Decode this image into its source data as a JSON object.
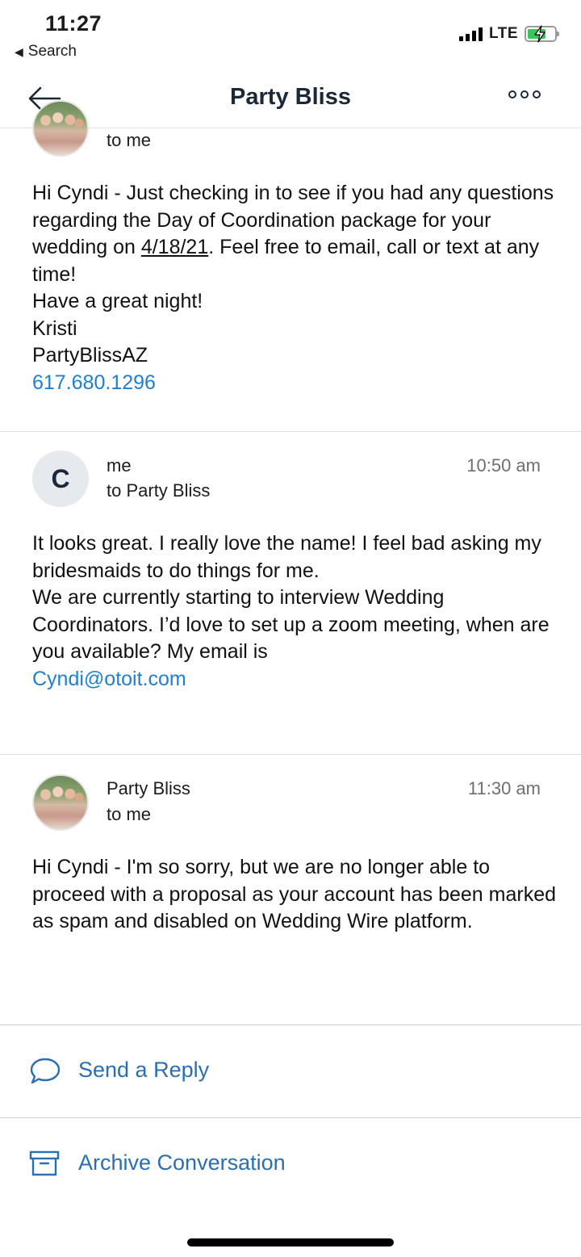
{
  "status_bar": {
    "time": "11:27",
    "back_label": "Search",
    "network": "LTE"
  },
  "nav": {
    "title": "Party Bliss"
  },
  "messages": [
    {
      "recipient": "to me",
      "paragraphs": {
        "p1_before": "Hi Cyndi - Just checking in to see if you had any questions regarding the Day of Coordination package for your wedding on ",
        "p1_date": "4/18/21",
        "p1_after": ". Feel free to email, call or text at any time!",
        "line2": "Have a great night!",
        "line3": "Kristi",
        "line4": "PartyBlissAZ",
        "phone": "617.680.1296"
      }
    },
    {
      "avatar_letter": "C",
      "sender": "me",
      "recipient": "to Party Bliss",
      "time": "10:50 am",
      "paragraphs": {
        "p1": "It looks great. I really love the name! I feel bad asking my bridesmaids to do things for me.",
        "p2": "We are currently starting to interview Wedding Coordinators. I’d love to set up a zoom meeting, when are you available? My email is",
        "email": "Cyndi@otoit.com"
      }
    },
    {
      "sender": "Party Bliss",
      "recipient": "to me",
      "time": "11:30 am",
      "paragraphs": {
        "p1": "Hi Cyndi - I'm so sorry, but we are no longer able to proceed with a proposal as your account has been marked as spam and disabled on Wedding Wire platform."
      }
    }
  ],
  "actions": {
    "reply_label": "Send a Reply",
    "archive_label": "Archive Conversation"
  },
  "colors": {
    "accent": "#2a6fb3",
    "link": "#1f7fd3",
    "title": "#1b2838"
  }
}
